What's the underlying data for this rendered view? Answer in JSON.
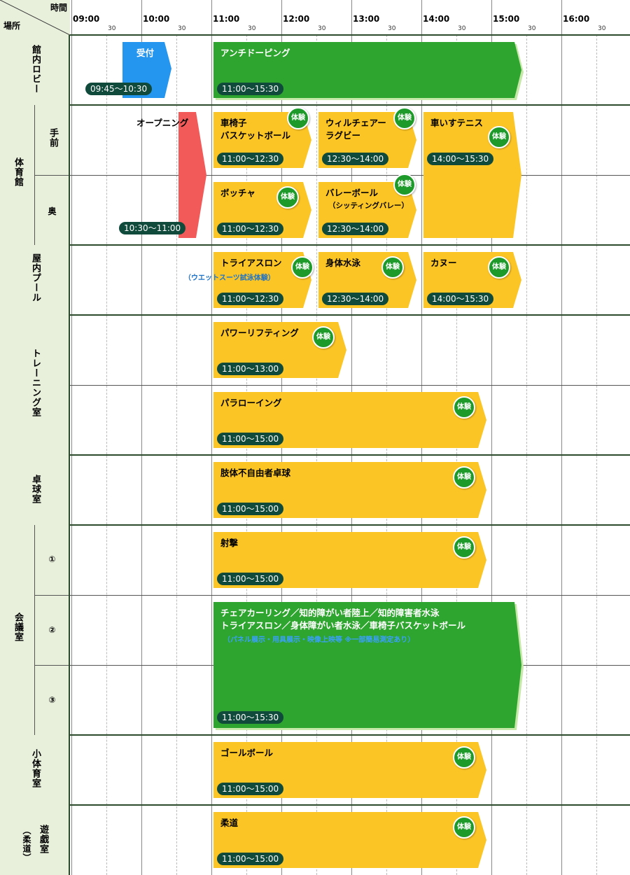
{
  "header": {
    "time_label": "時間",
    "place_label": "場所"
  },
  "hours": [
    "09:00",
    "10:00",
    "11:00",
    "12:00",
    "13:00",
    "14:00",
    "15:00",
    "16:00"
  ],
  "half_label": "30",
  "locations": {
    "lobby": "館内ロビー",
    "gym": "体育館",
    "gym_front": "手前",
    "gym_back": "奥",
    "pool": "屋内プール",
    "training": "トレーニング室",
    "tabletennis": "卓球室",
    "meeting": "会議室",
    "meeting_1": "①",
    "meeting_2": "②",
    "meeting_3": "③",
    "small_gym": "小体育室",
    "playroom": "遊戯室",
    "playroom_sub": "（柔道）"
  },
  "badge_label": "体験",
  "colors": {
    "yellow": "#fcc526",
    "green": "#2ea52e",
    "blue": "#2596f0",
    "red": "#f25a5a",
    "badge": "#1e9a2a",
    "time_pill": "#0f4a3a"
  },
  "events": {
    "reception": {
      "title": "受付",
      "time": "09:45〜10:30"
    },
    "antidoping": {
      "title": "アンチドーピング",
      "time": "11:00〜15:30"
    },
    "opening": {
      "title": "オープニング",
      "time": "10:30〜11:00"
    },
    "wheelchair_basketball": {
      "title1": "車椅子",
      "title2": "バスケットボール",
      "time": "11:00〜12:30"
    },
    "wheelchair_rugby": {
      "title1": "ウィルチェアー",
      "title2": "ラグビー",
      "time": "12:30〜14:00"
    },
    "wheelchair_tennis": {
      "title": "車いすテニス",
      "time": "14:00〜15:30"
    },
    "boccia": {
      "title": "ボッチャ",
      "time": "11:00〜12:30"
    },
    "volleyball": {
      "title": "バレーボール",
      "subtitle": "（シッティングバレー）",
      "time": "12:30〜14:00"
    },
    "triathlon": {
      "title": "トライアスロン",
      "note": "（ウエットスーツ試泳体験）",
      "time": "11:00〜12:30"
    },
    "swimming": {
      "title": "身体水泳",
      "time": "12:30〜14:00"
    },
    "canoe": {
      "title": "カヌー",
      "time": "14:00〜15:30"
    },
    "powerlifting": {
      "title": "パワーリフティング",
      "time": "11:00〜13:00"
    },
    "pararowing": {
      "title": "パラローイング",
      "time": "11:00〜15:00"
    },
    "table_tennis": {
      "title": "肢体不自由者卓球",
      "time": "11:00〜15:00"
    },
    "shooting": {
      "title": "射撃",
      "time": "11:00〜15:00"
    },
    "exhibit": {
      "line1": "チェアカーリング／知的障がい者陸上／知的障害者水泳",
      "line2": "トライアスロン／身体障がい者水泳／車椅子バスケットボール",
      "note": "（パネル展示・用具展示・映像上映等 ※一部簡易測定あり）",
      "time": "11:00〜15:30"
    },
    "goalball": {
      "title": "ゴールボール",
      "time": "11:00〜15:00"
    },
    "judo": {
      "title": "柔道",
      "time": "11:00〜15:00"
    }
  }
}
